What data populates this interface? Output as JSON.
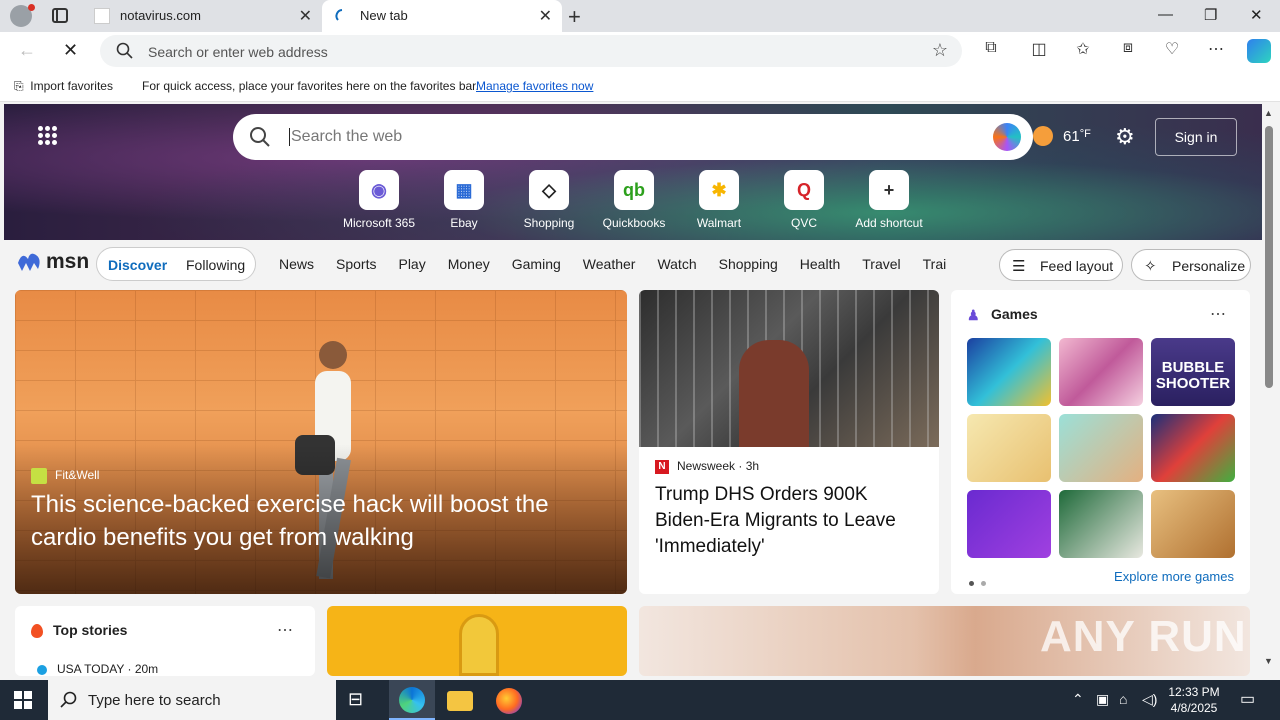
{
  "browser": {
    "tabs": [
      {
        "title": "notavirus.com"
      },
      {
        "title": "New tab"
      }
    ],
    "address_placeholder": "Search or enter web address",
    "favorites_bar": {
      "import_label": "Import favorites",
      "message": "For quick access, place your favorites here on the favorites bar.",
      "manage_link": "Manage favorites now"
    }
  },
  "hero": {
    "search_placeholder": "Search the web",
    "weather_temp": "61",
    "weather_unit": "°F",
    "signin_label": "Sign in",
    "shortcuts": [
      {
        "label": "Microsoft 365",
        "icon": "microsoft-365-icon",
        "glyph": "◉",
        "color": "#6b5bd6"
      },
      {
        "label": "Ebay",
        "icon": "ebay-icon",
        "glyph": "▦",
        "color": "#2b6bd6"
      },
      {
        "label": "Shopping",
        "icon": "shopping-tag-icon",
        "glyph": "◇",
        "color": "#222222"
      },
      {
        "label": "Quickbooks",
        "icon": "quickbooks-icon",
        "glyph": "qb",
        "color": "#2ca01c"
      },
      {
        "label": "Walmart",
        "icon": "walmart-icon",
        "glyph": "✱",
        "color": "#f7b500"
      },
      {
        "label": "QVC",
        "icon": "qvc-icon",
        "glyph": "Q",
        "color": "#d6242a"
      },
      {
        "label": "Add shortcut",
        "icon": "plus-icon",
        "glyph": "+",
        "color": "#333333"
      }
    ]
  },
  "msn": {
    "logo_text": "msn",
    "tabs": {
      "discover": "Discover",
      "following": "Following"
    },
    "categories": [
      "News",
      "Sports",
      "Play",
      "Money",
      "Gaming",
      "Weather",
      "Watch",
      "Shopping",
      "Health",
      "Travel",
      "Trai"
    ],
    "feed_layout_label": "Feed layout",
    "personalize_label": "Personalize"
  },
  "feed": {
    "hero_card": {
      "source": "Fit&Well",
      "headline": "This science-backed exercise hack will boost the cardio benefits you get from walking"
    },
    "news_card": {
      "source": "Newsweek",
      "age": "3h",
      "headline": "Trump DHS Orders 900K Biden-Era Migrants to Leave 'Immediately'"
    },
    "games": {
      "title": "Games",
      "explore_label": "Explore more games",
      "bubble_text": "BUBBLE SHOOTER"
    },
    "top_stories": {
      "title": "Top stories",
      "first_source": "USA TODAY",
      "first_age": "20m"
    },
    "watermark": "ANY RUN"
  },
  "taskbar": {
    "search_placeholder": "Type here to search",
    "time": "12:33 PM",
    "date": "4/8/2025"
  },
  "colors": {
    "accent": "#0f6cbd",
    "taskbar": "#1f2a37"
  }
}
